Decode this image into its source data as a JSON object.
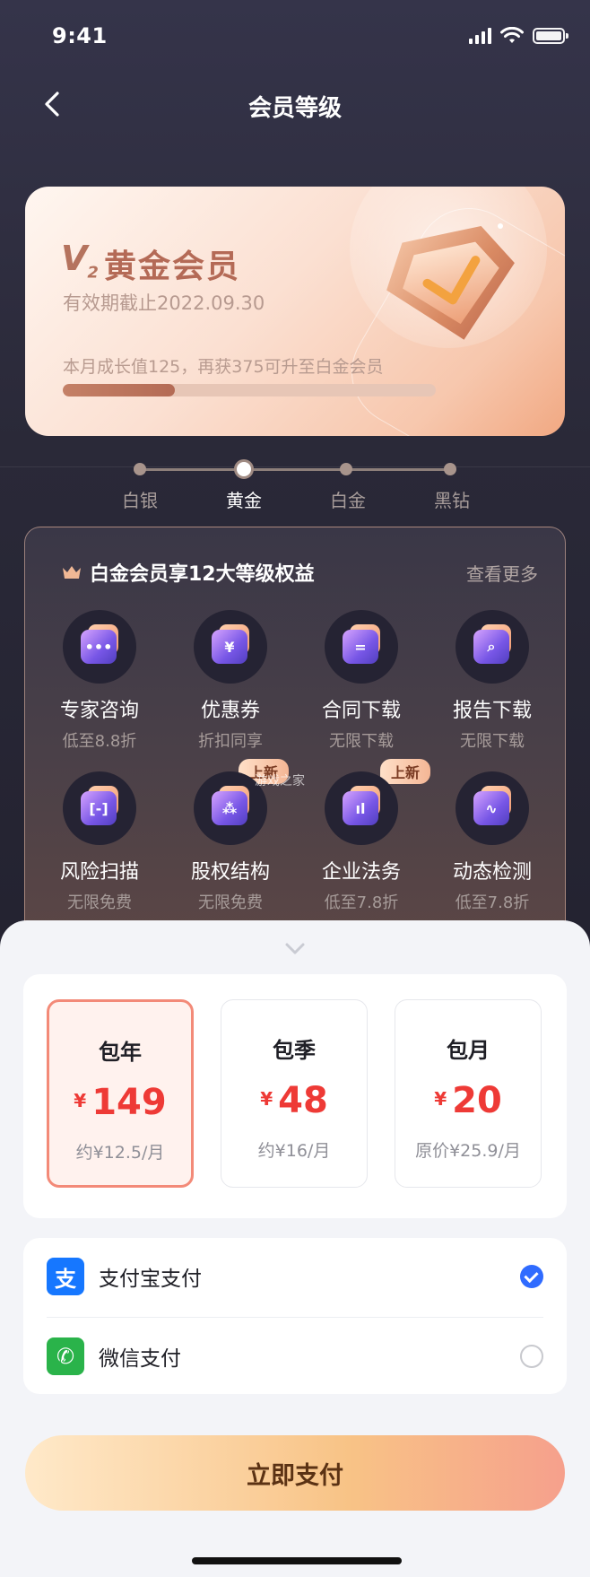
{
  "status": {
    "time": "9:41"
  },
  "nav": {
    "title": "会员等级"
  },
  "card": {
    "level_code": "V",
    "level_num": "2",
    "level_name": "黄金会员",
    "expire_text": "有效期截止2022.09.30",
    "growth_text": "本月成长值125，再获375可升至白金会员",
    "progress": 0.3
  },
  "levels": [
    "白银",
    "黄金",
    "白金",
    "黑钻"
  ],
  "current_level_index": 1,
  "benefits": {
    "title": "白金会员享12大等级权益",
    "more": "查看更多",
    "new_tag": "上新",
    "items": [
      {
        "name": "专家咨询",
        "desc": "低至8.8折",
        "icon": "chat-icon",
        "glyph": "•••"
      },
      {
        "name": "优惠券",
        "desc": "折扣同享",
        "icon": "coupon-icon",
        "glyph": "¥"
      },
      {
        "name": "合同下载",
        "desc": "无限下载",
        "icon": "contract-icon",
        "glyph": "="
      },
      {
        "name": "报告下载",
        "desc": "无限下载",
        "icon": "report-search-icon",
        "glyph": "⌕"
      },
      {
        "name": "风险扫描",
        "desc": "无限免费",
        "icon": "scan-icon",
        "glyph": "[-]"
      },
      {
        "name": "股权结构",
        "desc": "无限免费",
        "icon": "structure-icon",
        "glyph": "⁂"
      },
      {
        "name": "企业法务",
        "desc": "低至7.8折",
        "icon": "legal-chart-icon",
        "glyph": "ıl"
      },
      {
        "name": "动态检测",
        "desc": "低至7.8折",
        "icon": "pulse-icon",
        "glyph": "∿"
      }
    ]
  },
  "plans": [
    {
      "name": "包年",
      "currency": "¥",
      "price": "149",
      "note": "约¥12.5/月"
    },
    {
      "name": "包季",
      "currency": "¥",
      "price": "48",
      "note": "约¥16/月"
    },
    {
      "name": "包月",
      "currency": "¥",
      "price": "20",
      "note": "原价¥25.9/月"
    }
  ],
  "selected_plan_index": 0,
  "payment": {
    "methods": [
      {
        "label": "支付宝支付",
        "icon": "alipay-icon",
        "glyph": "支",
        "color": "#1677ff",
        "checked": true
      },
      {
        "label": "微信支付",
        "icon": "wechat-icon",
        "glyph": "✆",
        "color": "#2ab34a",
        "checked": false
      }
    ]
  },
  "pay_button": "立即支付",
  "watermark": "游戏之家"
}
